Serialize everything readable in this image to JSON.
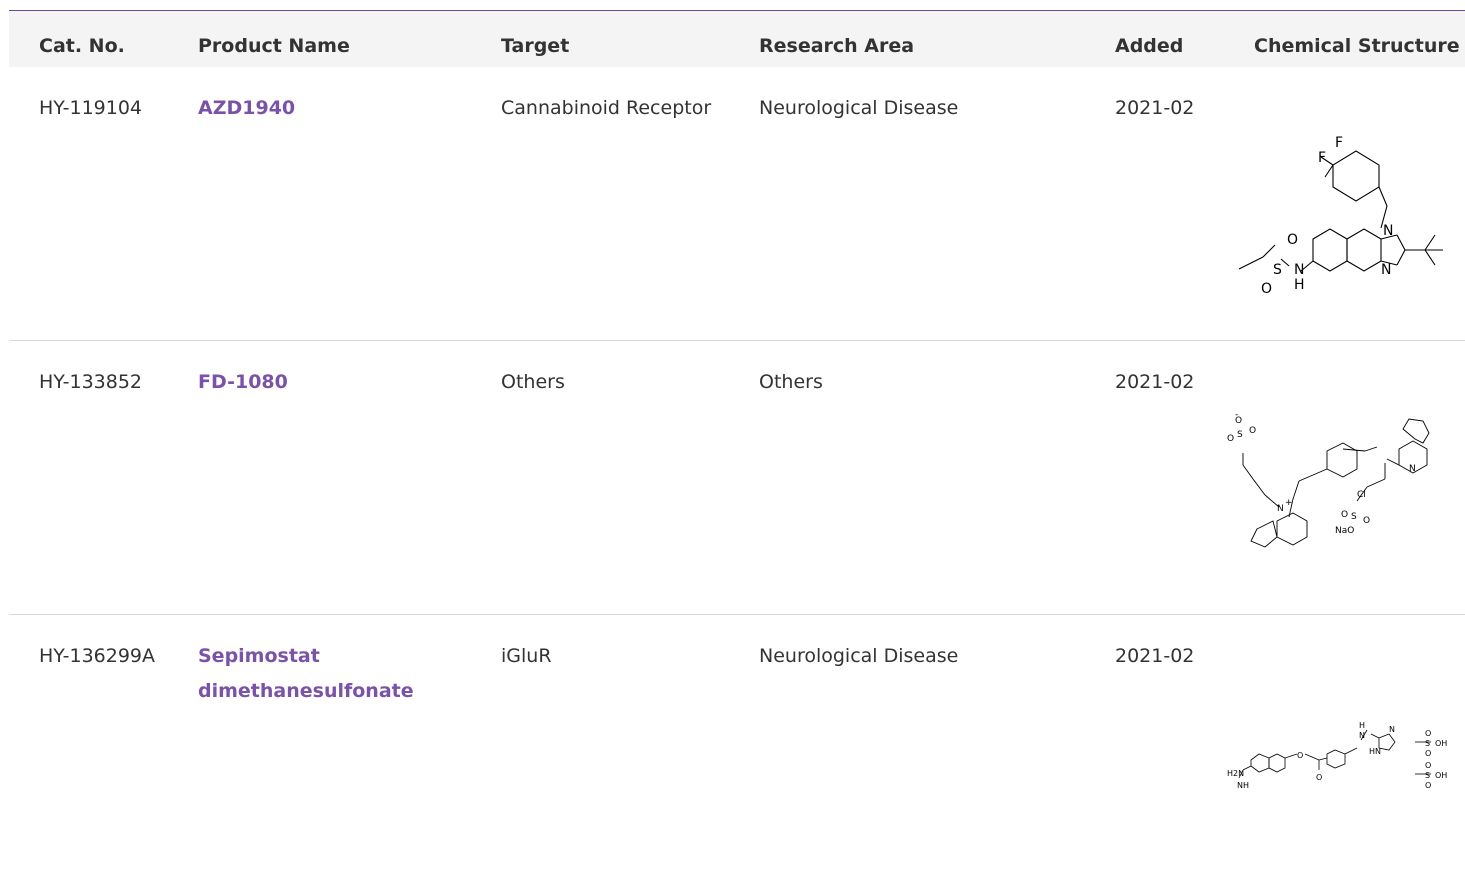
{
  "table": {
    "headers": {
      "cat_no": "Cat. No.",
      "product_name": "Product Name",
      "target": "Target",
      "research_area": "Research Area",
      "added": "Added",
      "structure": "Chemical Structure"
    },
    "rows": [
      {
        "cat_no": "HY-119104",
        "product_name": "AZD1940",
        "target": "Cannabinoid Receptor",
        "research_area": "Neurological Disease",
        "added": "2021-02"
      },
      {
        "cat_no": "HY-133852",
        "product_name": "FD-1080",
        "target": "Others",
        "research_area": "Others",
        "added": "2021-02"
      },
      {
        "cat_no": "HY-136299A",
        "product_name": "Sepimostat dimethanesulfonate",
        "target": "iGluR",
        "research_area": "Neurological Disease",
        "added": "2021-02"
      }
    ]
  },
  "colors": {
    "accent": "#7a52a8",
    "border": "#6b4a9b",
    "header_bg": "#f4f4f4"
  },
  "structure_labels": {
    "azd1940": {
      "F1": "F",
      "F2": "F",
      "N1": "N",
      "N2": "N",
      "O1": "O",
      "O2": "O",
      "S": "S",
      "NH_N": "N",
      "NH_H": "H"
    },
    "fd1080": {
      "O_minus": "O",
      "minus": "-",
      "S1": "S",
      "O1": "O",
      "O2": "O",
      "N_plus": "N",
      "plus": "+",
      "N2": "N",
      "Cl": "Cl",
      "S2": "S",
      "O3": "O",
      "O4": "O",
      "NaO": "NaO"
    },
    "sepimostat": {
      "H2N": "H2N",
      "NH": "NH",
      "O1": "O",
      "O2": "O",
      "H": "H",
      "N": "N",
      "HN": "HN",
      "N2": "N",
      "S1": "S",
      "O3": "O",
      "O4": "O",
      "OH1": "OH",
      "S2": "S",
      "O5": "O",
      "O6": "O",
      "OH2": "OH"
    }
  }
}
